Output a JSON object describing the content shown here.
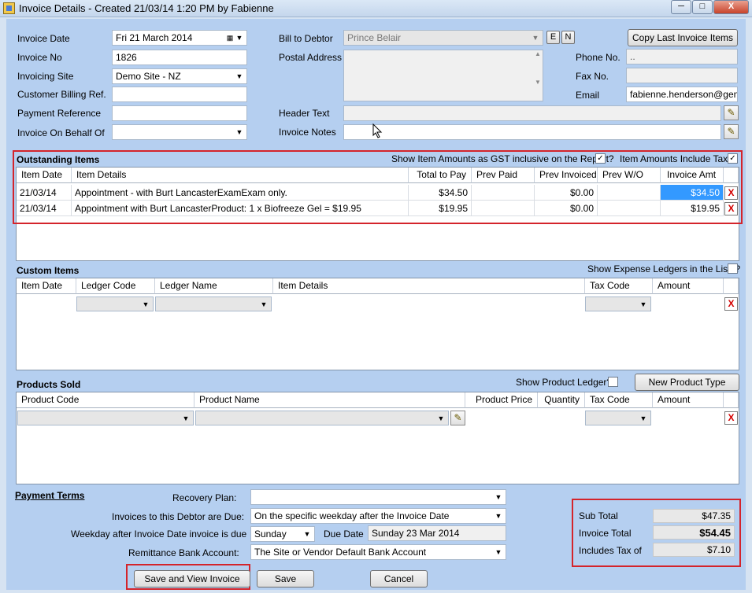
{
  "window": {
    "title": "Invoice Details - Created 21/03/14 1:20 PM by Fabienne",
    "min_label": "─",
    "max_label": "□",
    "close_label": "X"
  },
  "header": {
    "invoice_date_label": "Invoice Date",
    "invoice_date_value": "Fri    21    March    2014",
    "invoice_no_label": "Invoice No",
    "invoice_no_value": "1826",
    "invoicing_site_label": "Invoicing Site",
    "invoicing_site_value": "Demo Site - NZ",
    "customer_billing_label": "Customer Billing Ref.",
    "customer_billing_value": "",
    "payment_ref_label": "Payment Reference",
    "payment_ref_value": "",
    "behalf_label": "Invoice On Behalf Of",
    "behalf_value": "",
    "bill_to_label": "Bill to Debtor",
    "bill_to_value": "Prince Belair",
    "e_label": "E",
    "n_label": "N",
    "postal_label": "Postal Address",
    "postal_value": "",
    "header_text_label": "Header Text",
    "header_text_value": "",
    "invoice_notes_label": "Invoice Notes",
    "invoice_notes_value": "",
    "copy_last_label": "Copy Last Invoice Items",
    "phone_label": "Phone No.",
    "phone_value": "..",
    "fax_label": "Fax No.",
    "fax_value": "",
    "email_label": "Email",
    "email_value": "fabienne.henderson@gensol"
  },
  "outstanding": {
    "title": "Outstanding Items",
    "gst_label": "Show Item Amounts as GST inclusive on the Report?",
    "gst_checked": "✓",
    "tax_label": "Item Amounts Include Tax?",
    "tax_checked": "✓",
    "columns": [
      "Item Date",
      "Item Details",
      "Total to Pay",
      "Prev Paid",
      "Prev Invoiced",
      "Prev W/O",
      "Invoice Amt"
    ],
    "rows": [
      {
        "date": "21/03/14",
        "details": "Appointment - with Burt LancasterExamExam only.",
        "total": "$34.50",
        "paid": "",
        "invoiced": "$0.00",
        "wo": "",
        "amt": "$34.50"
      },
      {
        "date": "21/03/14",
        "details": "Appointment with Burt LancasterProduct: 1 x Biofreeze Gel = $19.95",
        "total": "$19.95",
        "paid": "",
        "invoiced": "$0.00",
        "wo": "",
        "amt": "$19.95"
      }
    ]
  },
  "custom": {
    "title": "Custom Items",
    "show_expense_label": "Show Expense Ledgers in the Lists?",
    "columns": [
      "Item Date",
      "Ledger Code",
      "Ledger Name",
      "Item Details",
      "Tax Code",
      "Amount"
    ]
  },
  "products": {
    "title": "Products Sold",
    "show_ledger_label": "Show Product Ledger?",
    "new_type_label": "New Product Type",
    "columns": [
      "Product Code",
      "Product Name",
      "Product Price",
      "Quantity",
      "Tax Code",
      "Amount"
    ]
  },
  "payment": {
    "title": "Payment Terms",
    "recovery_label": "Recovery Plan:",
    "recovery_value": "",
    "due_label": "Invoices to this Debtor are Due:",
    "due_value": "On the specific weekday after the Invoice Date",
    "weekday_label": "Weekday after Invoice Date invoice is due",
    "weekday_value": "Sunday",
    "due_date_label": "Due Date",
    "due_date_value": "Sunday 23 Mar 2014",
    "bank_label": "Remittance Bank Account:",
    "bank_value": "The Site or Vendor Default Bank Account"
  },
  "totals": {
    "sub_label": "Sub Total",
    "sub_value": "$47.35",
    "total_label": "Invoice Total",
    "total_value": "$54.45",
    "tax_label": "Includes Tax of",
    "tax_value": "$7.10"
  },
  "buttons": {
    "save_view": "Save and View Invoice",
    "save": "Save",
    "cancel": "Cancel"
  },
  "icons": {
    "pencil": "✎",
    "x": "X",
    "arrow": "▼",
    "calendar": "▦"
  },
  "colors": {
    "highlight": "#d4242b",
    "selection": "#3399ff"
  }
}
